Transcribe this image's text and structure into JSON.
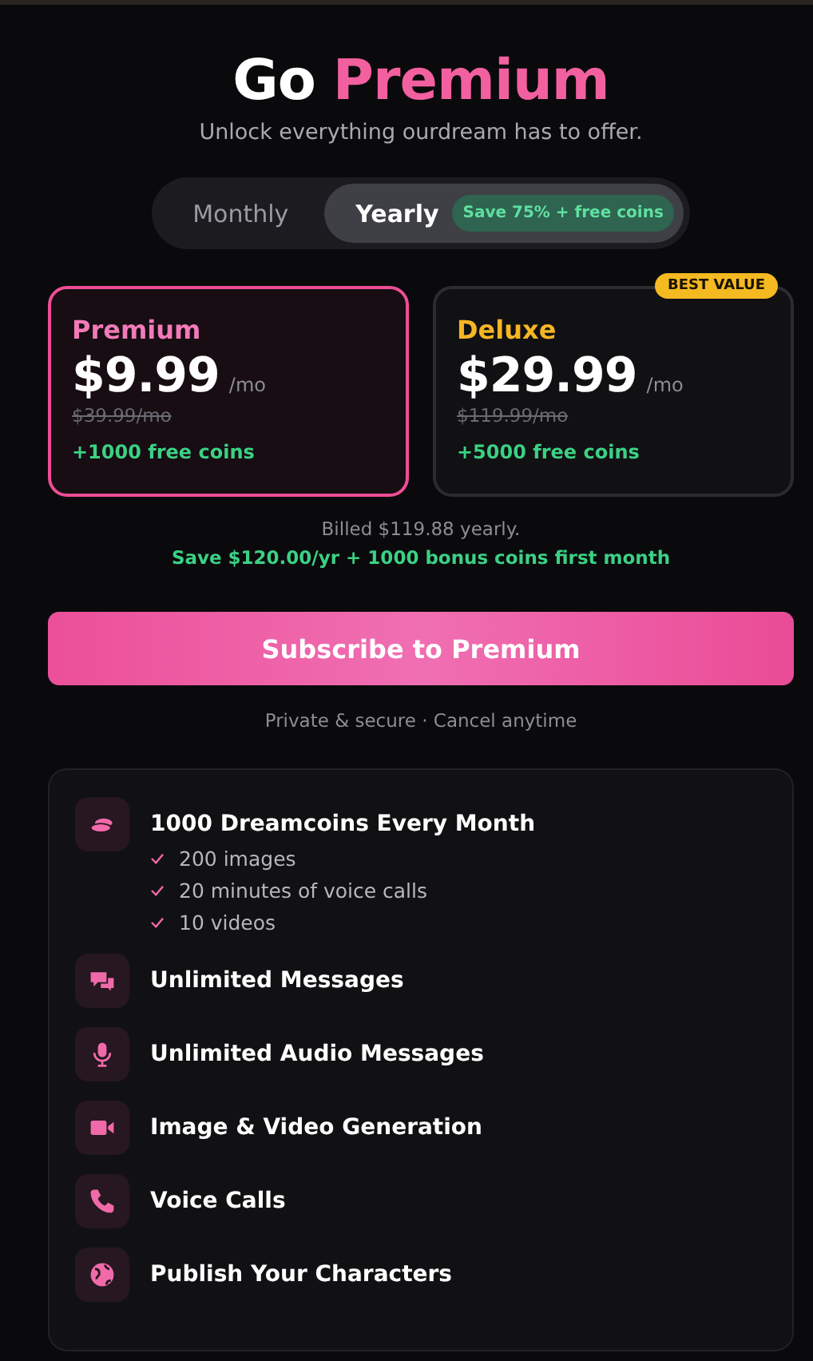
{
  "header": {
    "title_lead": "Go",
    "title_accent": "Premium",
    "subtitle": "Unlock everything ourdream has to offer."
  },
  "billing_toggle": [
    {
      "label": "Monthly",
      "selected": false
    },
    {
      "label": "Yearly",
      "selected": true,
      "badge": "Save 75% + free coins"
    }
  ],
  "plans": [
    {
      "name": "Premium",
      "color": "#f27ab8",
      "price": "$9.99",
      "per": "/mo",
      "old_price": "$39.99/mo",
      "coins": "+1000 free coins",
      "selected": true
    },
    {
      "name": "Deluxe",
      "color": "#f5b524",
      "price": "$29.99",
      "per": "/mo",
      "old_price": "$119.99/mo",
      "coins": "+5000 free coins",
      "selected": false,
      "badge": "BEST VALUE"
    }
  ],
  "billing_note": "Billed $119.88 yearly.",
  "savings_note": "Save $120.00/yr + 1000 bonus coins first month",
  "subscribe_button": "Subscribe to Premium",
  "trust_note": "Private & secure · Cancel anytime",
  "features": [
    {
      "kind": "coins",
      "title": "1000 Dreamcoins Every Month",
      "details": [
        "200 images",
        "20 minutes of voice calls",
        "10 videos"
      ]
    },
    {
      "kind": "chat",
      "title": "Unlimited Messages"
    },
    {
      "kind": "mic",
      "title": "Unlimited Audio Messages"
    },
    {
      "kind": "video",
      "title": "Image & Video Generation"
    },
    {
      "kind": "phone",
      "title": "Voice Calls"
    },
    {
      "kind": "globe",
      "title": "Publish Your Characters"
    }
  ]
}
